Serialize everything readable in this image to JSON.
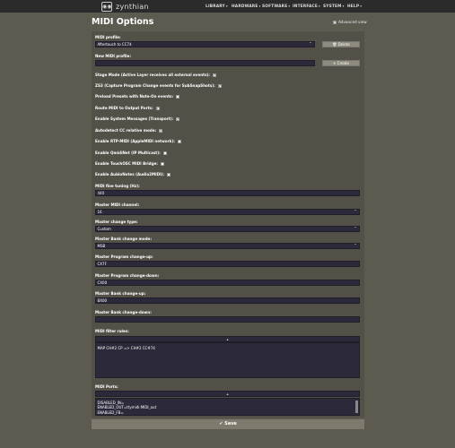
{
  "header": {
    "brand": "zynthian",
    "logo_mark": "◉◉",
    "menu": [
      {
        "label": "LIBRARY",
        "caret": "▾"
      },
      {
        "label": "HARDWARE",
        "caret": "▾"
      },
      {
        "label": "SOFTWARE",
        "caret": "▾"
      },
      {
        "label": "INTERFACE",
        "caret": "▾"
      },
      {
        "label": "SYSTEM",
        "caret": "▾"
      },
      {
        "label": "HELP",
        "caret": "▾"
      }
    ]
  },
  "page": {
    "title": "MIDI Options",
    "advanced_view": {
      "label": "Advanced view",
      "checked": true
    }
  },
  "form": {
    "midi_profile": {
      "label": "MIDI profile:",
      "value": "Aftertouch to CC74",
      "delete_label": "🗑 Delete"
    },
    "new_profile": {
      "label": "New MIDI profile:",
      "value": "",
      "create_label": "+ Create"
    },
    "checkboxes": [
      {
        "label": "Stage Mode (Active Layer receives all external events):",
        "checked": true
      },
      {
        "label": "ZS3 (Capture Program Change events for SubSnapShots):",
        "checked": true
      },
      {
        "label": "Preload Presets with Note-On events:",
        "checked": false
      },
      {
        "label": "Route MIDI to Output Ports:",
        "checked": true
      },
      {
        "label": "Enable System Messages (Transport):",
        "checked": true
      },
      {
        "label": "Autodetect CC relative mode:",
        "checked": true
      },
      {
        "label": "Enable RTP-MIDI (AppleMIDI network):",
        "checked": false
      },
      {
        "label": "Enable QmidiNet (IP Multicast):",
        "checked": false
      },
      {
        "label": "Enable TouchOSC MIDI Bridge:",
        "checked": false
      },
      {
        "label": "Enable AubioNotes (Audio2MIDI):",
        "checked": false
      }
    ],
    "fine_tuning": {
      "label": "MIDI fine tuning (Hz):",
      "value": "440"
    },
    "master_channel": {
      "label": "Master MIDI channel:",
      "value": "16"
    },
    "master_change_type": {
      "label": "Master change type:",
      "value": "Custom"
    },
    "master_bank_mode": {
      "label": "Master Bank change mode:",
      "value": "MSB"
    },
    "master_prog_up": {
      "label": "Master Program change-up:",
      "value": "CX7F"
    },
    "master_prog_down": {
      "label": "Master Program change-down:",
      "value": "CX00"
    },
    "master_bank_up": {
      "label": "Master Bank change-up:",
      "value": "BX00"
    },
    "master_bank_down": {
      "label": "Master Bank change-down:",
      "value": ""
    },
    "filter_rules": {
      "label": "MIDI filter rules:",
      "head": "▴",
      "value": "MAP CH#2 CP => CH#2 CC#74"
    },
    "ports": {
      "label": "MIDI Ports:",
      "head": "▴",
      "lines": [
        "DISABLED_IN=",
        "ENABLED_OUT=ttymidi:MIDI_out",
        "ENABLED_FB="
      ]
    }
  },
  "footer": {
    "save_label": "✔ Save"
  },
  "colors": {
    "background": "#5d5a50",
    "panel": "#535047",
    "field": "#2c2a3a",
    "topbar": "#2b2b2b",
    "button": "#8e8a7c"
  }
}
